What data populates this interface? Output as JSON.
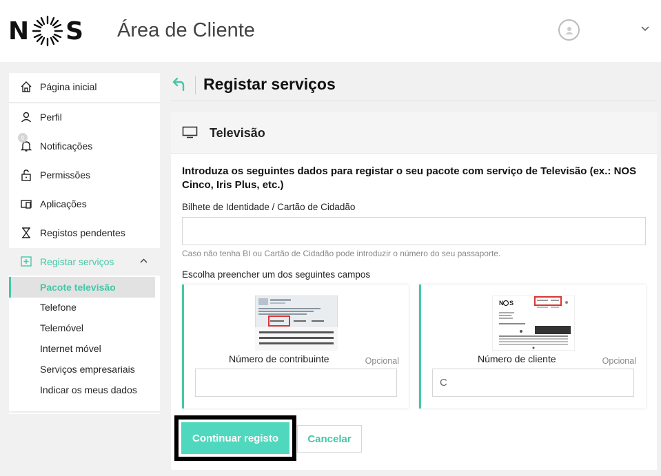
{
  "header": {
    "logo_left": "N",
    "logo_right": "S",
    "app_title": "Área de Cliente",
    "avatar_icon": "user-icon",
    "menu_icon": "chevron-down-icon"
  },
  "sidebar": {
    "items": [
      {
        "label": "Página inicial",
        "icon": "home-icon"
      },
      {
        "label": "Perfil",
        "icon": "user-icon"
      },
      {
        "label": "Notificações",
        "icon": "bell-icon",
        "badge": "0"
      },
      {
        "label": "Permissões",
        "icon": "lock-icon"
      },
      {
        "label": "Aplicações",
        "icon": "devices-icon"
      },
      {
        "label": "Registos pendentes",
        "icon": "hourglass-icon"
      },
      {
        "label": "Registar serviços",
        "icon": "add-service-icon"
      }
    ],
    "sub_items": [
      {
        "label": "Pacote televisão"
      },
      {
        "label": "Telefone"
      },
      {
        "label": "Telemóvel"
      },
      {
        "label": "Internet móvel"
      },
      {
        "label": "Serviços empresariais"
      },
      {
        "label": "Indicar os meus dados"
      }
    ]
  },
  "page": {
    "title": "Registar serviços",
    "back_icon": "back-arrow-icon"
  },
  "card": {
    "title": "Televisão",
    "icon": "tv-icon",
    "intro": "Introduza os seguintes dados para registar o seu pacote com serviço de Televisão (ex.: NOS Cinco, Iris Plus, etc.)",
    "bi_label": "Bilhete de Identidade / Cartão de Cidadão",
    "bi_value": "",
    "bi_hint": "Caso não tenha BI ou Cartão de Cidadão pode introduzir o número do seu passaporte.",
    "choose_label": "Escolha preencher um dos seguintes campos",
    "options": [
      {
        "label": "Número de contribuinte",
        "optional": "Opcional",
        "value": ""
      },
      {
        "label": "Número de cliente",
        "optional": "Opcional",
        "value": "C"
      }
    ]
  },
  "buttons": {
    "continue": "Continuar registo",
    "cancel": "Cancelar"
  },
  "colors": {
    "accent": "#44c7a8",
    "button": "#4fd8bd"
  }
}
